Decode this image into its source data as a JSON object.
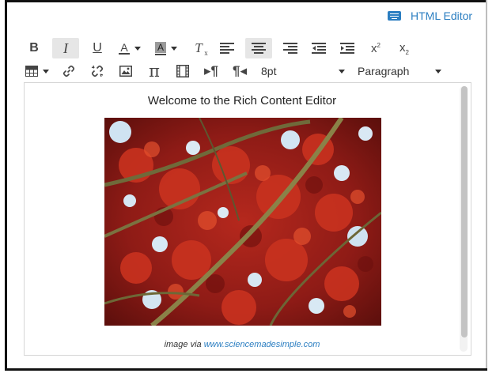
{
  "header": {
    "html_editor_label": "HTML Editor",
    "html_editor_icon": "keyboard-icon"
  },
  "toolbar": {
    "row1": [
      {
        "name": "bold-button",
        "icon": "bold-icon"
      },
      {
        "name": "italic-button",
        "icon": "italic-icon",
        "active": true
      },
      {
        "name": "underline-button",
        "icon": "underline-icon"
      },
      {
        "name": "text-color-button",
        "icon": "text-color-icon",
        "dropdown": true
      },
      {
        "name": "background-color-button",
        "icon": "background-color-icon",
        "dropdown": true
      },
      {
        "name": "clear-formatting-button",
        "icon": "clear-formatting-icon"
      },
      {
        "name": "align-left-button",
        "icon": "align-left-icon"
      },
      {
        "name": "align-center-button",
        "icon": "align-center-icon",
        "active": true
      },
      {
        "name": "align-right-button",
        "icon": "align-right-icon"
      },
      {
        "name": "outdent-button",
        "icon": "outdent-icon"
      },
      {
        "name": "indent-button",
        "icon": "indent-icon"
      },
      {
        "name": "superscript-button",
        "icon": "superscript-icon"
      },
      {
        "name": "subscript-button",
        "icon": "subscript-icon"
      }
    ],
    "row2": [
      {
        "name": "table-button",
        "icon": "table-icon",
        "dropdown": true
      },
      {
        "name": "link-button",
        "icon": "link-icon"
      },
      {
        "name": "unlink-button",
        "icon": "unlink-icon"
      },
      {
        "name": "image-button",
        "icon": "image-icon"
      },
      {
        "name": "equation-button",
        "icon": "pi-icon"
      },
      {
        "name": "media-button",
        "icon": "film-icon"
      },
      {
        "name": "ltr-button",
        "icon": "ltr-icon"
      },
      {
        "name": "rtl-button",
        "icon": "rtl-icon"
      }
    ],
    "font_size": "8pt",
    "paragraph_format": "Paragraph"
  },
  "content": {
    "heading": "Welcome to the Rich Content Editor",
    "caption_prefix": "image via ",
    "caption_link": "www.sciencemadesimple.com",
    "image": {
      "icon": "red-maple-leaves-photo"
    }
  },
  "colors": {
    "accent": "#2b7ec1",
    "frame": "#111111",
    "scrollbar": "#c4c4c4"
  }
}
